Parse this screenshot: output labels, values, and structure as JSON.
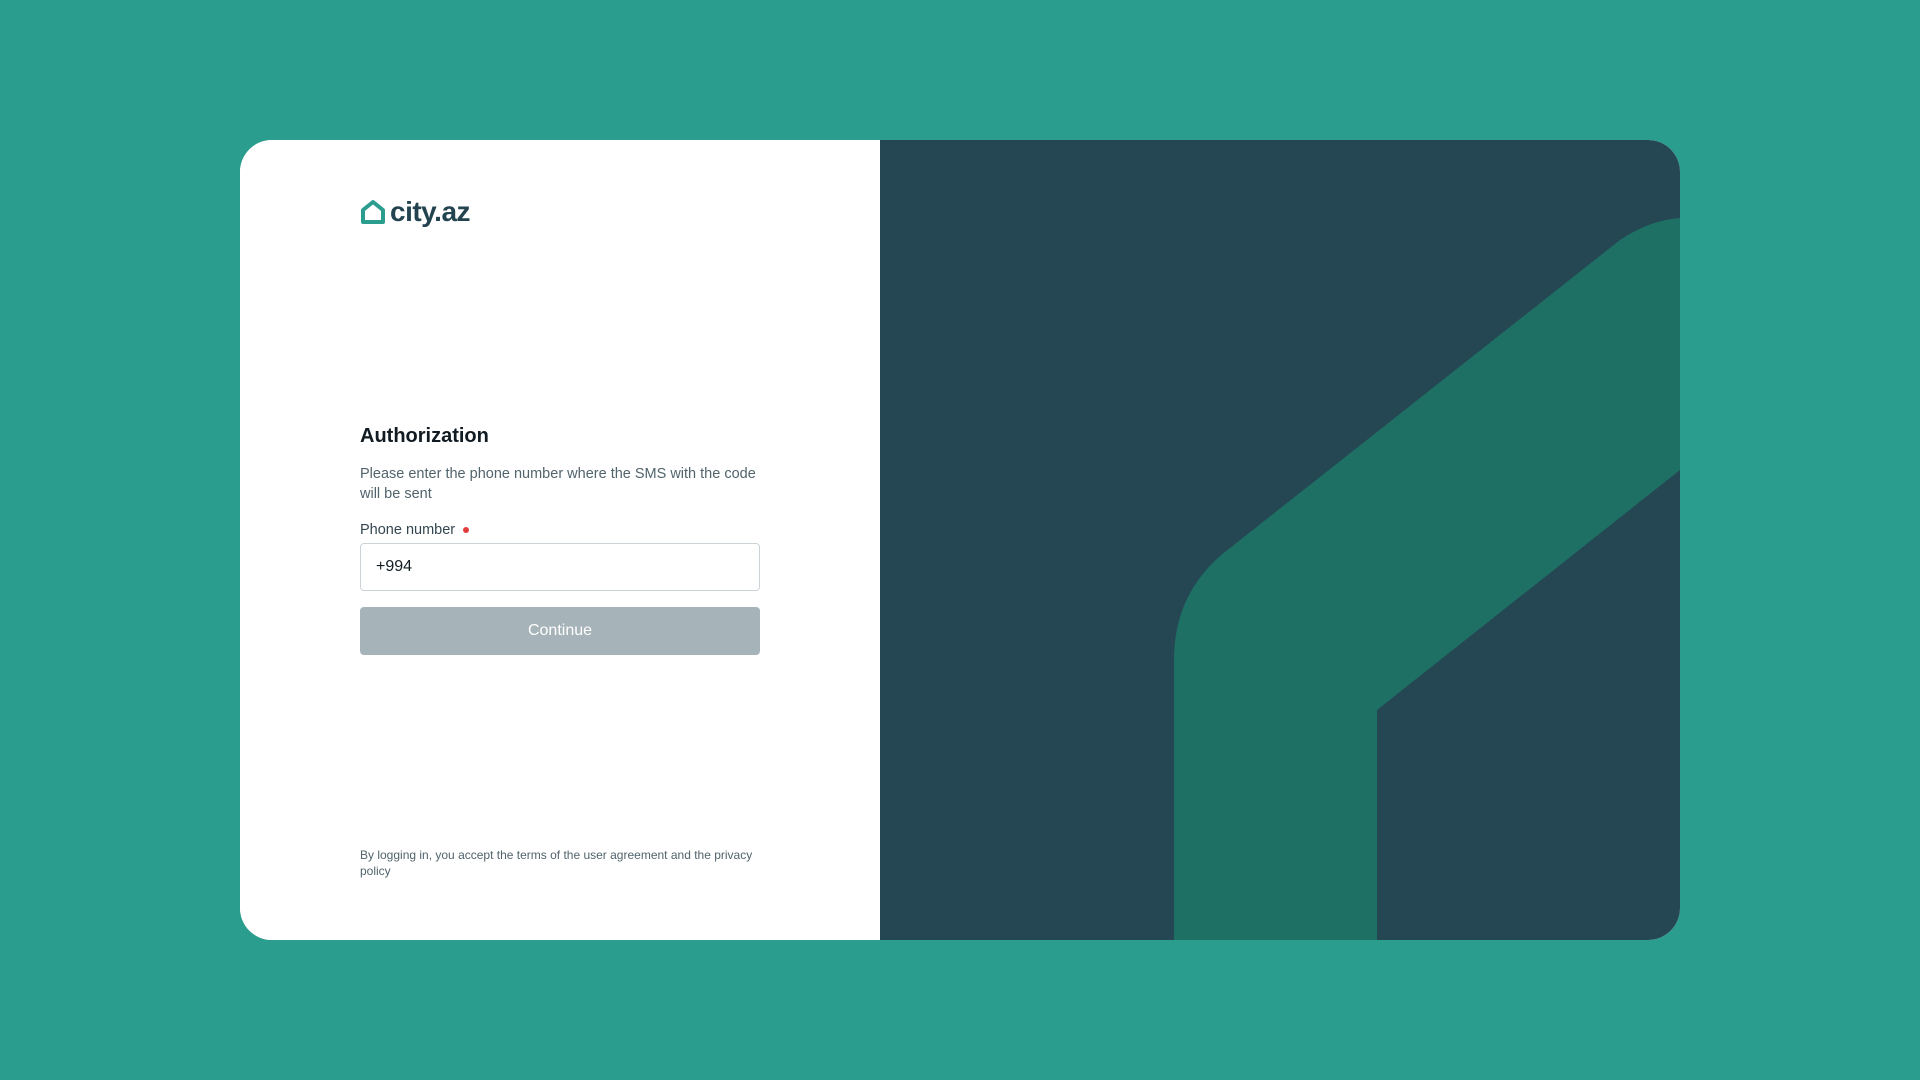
{
  "brand": {
    "name": "city.az",
    "icon": "house-icon",
    "color": "#2a9d8f"
  },
  "auth": {
    "title": "Authorization",
    "subtitle": "Please enter the phone number where the SMS with the code will be sent",
    "phone_label": "Phone number",
    "phone_value": "+994",
    "continue_label": "Continue",
    "terms": "By logging in, you accept the terms of the user agreement and the privacy policy"
  },
  "colors": {
    "background": "#2a9d8f",
    "panel_dark": "#254653",
    "panel_accent": "#1e7064",
    "button_disabled": "#a6b3b8",
    "required": "#e23c3c"
  }
}
